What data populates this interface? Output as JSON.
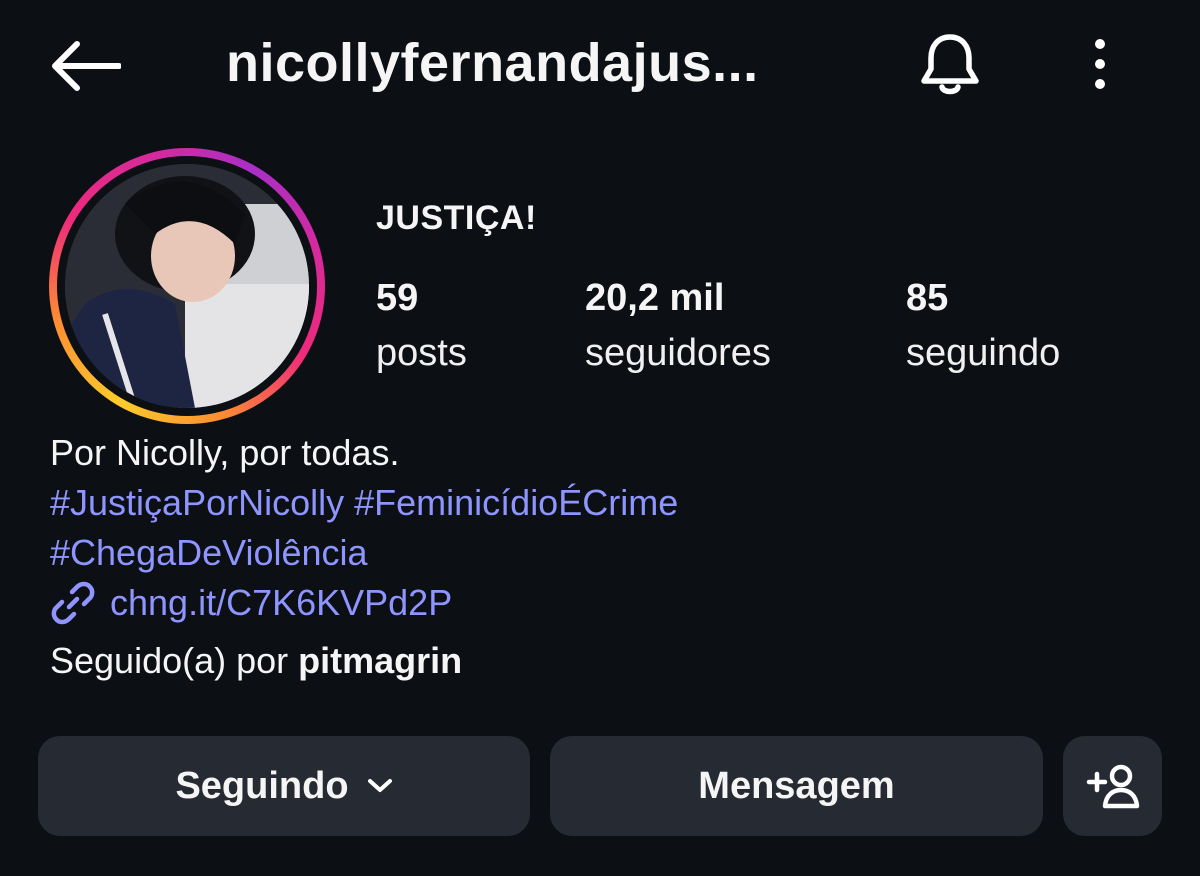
{
  "header": {
    "username": "nicollyfernandajus...",
    "icons": {
      "back": "arrow-left-icon",
      "notifications": "bell-icon",
      "more": "more-vertical-icon"
    }
  },
  "profile": {
    "display_name": "JUSTIÇA!",
    "stats": [
      {
        "value": "59",
        "label": "posts"
      },
      {
        "value": "20,2 mil",
        "label": "seguidores"
      },
      {
        "value": "85",
        "label": "seguindo"
      }
    ],
    "bio": {
      "line1": "Por Nicolly, por todas.",
      "hashtags": [
        "#JustiçaPorNicolly",
        "#FeminicídioÉCrime",
        "#ChegaDeViolência"
      ],
      "link": "chng.it/C7K6KVPd2P",
      "followed_by_prefix": "Seguido(a) por",
      "followed_by_user": "pitmagrin"
    }
  },
  "actions": {
    "following_label": "Seguindo",
    "message_label": "Mensagem",
    "add_icon": "add-person-icon"
  },
  "colors": {
    "background": "#0c0f14",
    "link": "#8e95ff",
    "button": "#262a33"
  }
}
